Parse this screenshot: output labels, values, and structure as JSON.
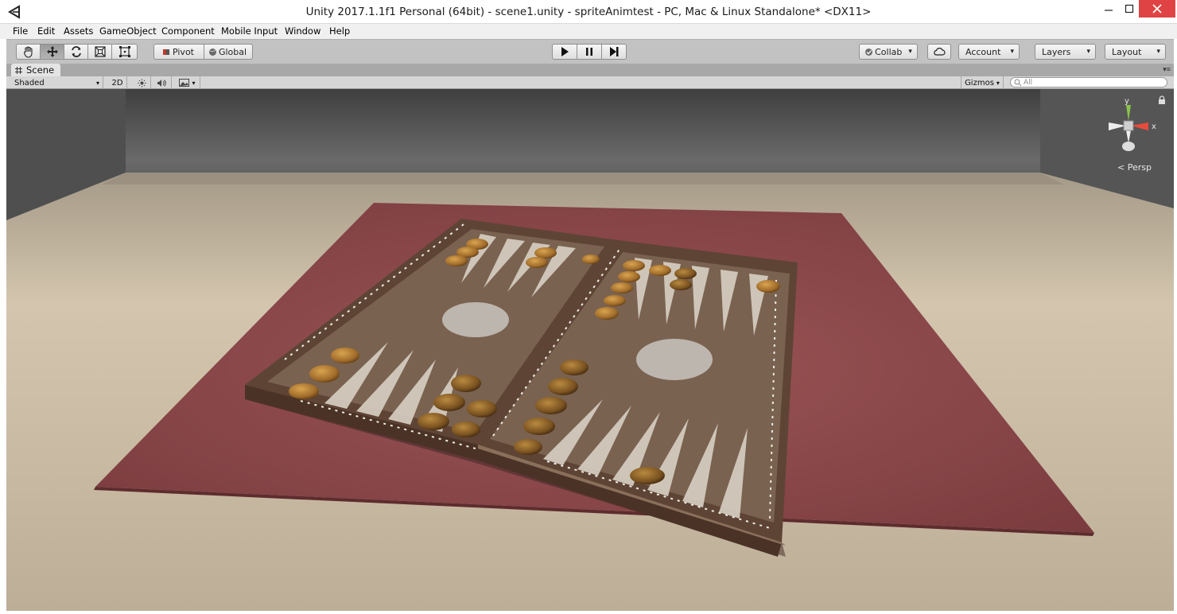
{
  "window": {
    "title": "Unity 2017.1.1f1 Personal (64bit) - scene1.unity - spriteAnimtest - PC, Mac & Linux Standalone* <DX11>",
    "app_icon": "unity-logo-icon",
    "controls": [
      "minimize-icon",
      "maximize-icon",
      "close-icon"
    ]
  },
  "menu": [
    "File",
    "Edit",
    "Assets",
    "GameObject",
    "Component",
    "Mobile Input",
    "Window",
    "Help"
  ],
  "toolbar": {
    "tools": [
      "hand-tool-icon",
      "move-tool-icon",
      "rotate-tool-icon",
      "scale-tool-icon",
      "rect-tool-icon"
    ],
    "active_tool": "move-tool-icon",
    "pivot_label": "Pivot",
    "global_label": "Global",
    "play_controls": [
      "play-icon",
      "pause-icon",
      "step-icon"
    ],
    "collab_label": "Collab",
    "account_label": "Account",
    "layers_label": "Layers",
    "layout_label": "Layout"
  },
  "scene_tab": {
    "label": "Scene"
  },
  "scene_bar": {
    "shading_mode": "Shaded",
    "mode_2d": "2D",
    "gizmos_label": "Gizmos",
    "search_placeholder": "All"
  },
  "viewport": {
    "projection_label": "Persp",
    "gizmo_axes": {
      "y": "y",
      "x": "x"
    },
    "colors": {
      "floor": "#c9b9a0",
      "rug": "#8a4a4c",
      "board_wood": "#6b5443",
      "triangle_light": "#d8d0c4",
      "wall": "#5a5a5a",
      "checker": "#a87a3a"
    }
  }
}
